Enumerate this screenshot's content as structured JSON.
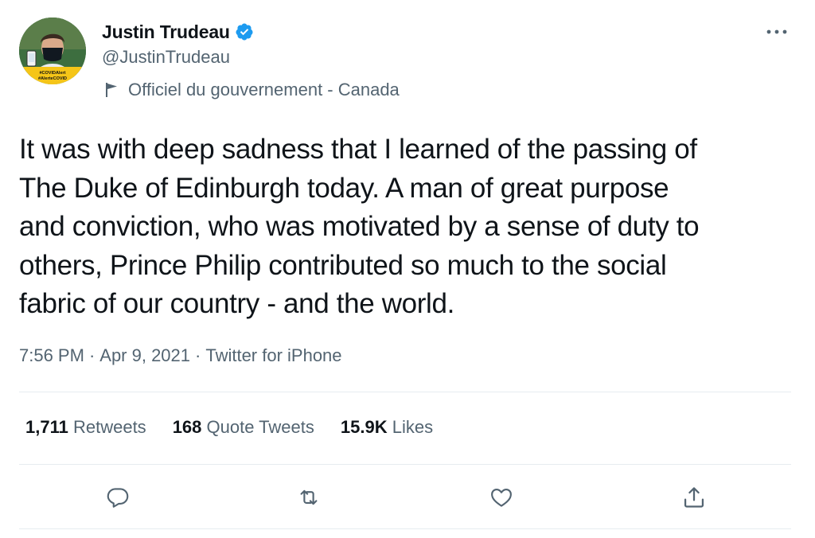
{
  "author": {
    "display_name": "Justin Trudeau",
    "handle": "@JustinTrudeau",
    "verified": true,
    "label": "Officiel du gouvernement - Canada",
    "avatar_badge_lines": [
      "#COVIDAlert",
      "#AlerteCOVID"
    ]
  },
  "tweet": {
    "text": "It was with deep sadness that I learned of the passing of\nThe Duke of Edinburgh today. A man of great purpose\nand conviction, who was motivated by a sense of duty to\nothers, Prince Philip contributed so much to the social\nfabric of our country - and the world.",
    "time": "7:56 PM",
    "date": "Apr 9, 2021",
    "source": "Twitter for iPhone",
    "separator": "·"
  },
  "stats": {
    "retweets_count": "1,711",
    "retweets_label": "Retweets",
    "quotes_count": "168",
    "quotes_label": "Quote Tweets",
    "likes_count": "15.9K",
    "likes_label": "Likes"
  },
  "icons": {
    "more": "more-horizontal-icon",
    "verified": "verified-badge-icon",
    "government_label": "flag-icon",
    "reply": "reply-icon",
    "retweet": "retweet-icon",
    "like": "heart-icon",
    "share": "share-icon"
  },
  "colors": {
    "text_primary": "#0f1419",
    "text_secondary": "#536471",
    "verified_blue": "#1d9bf0",
    "divider": "#e6ecf0"
  }
}
